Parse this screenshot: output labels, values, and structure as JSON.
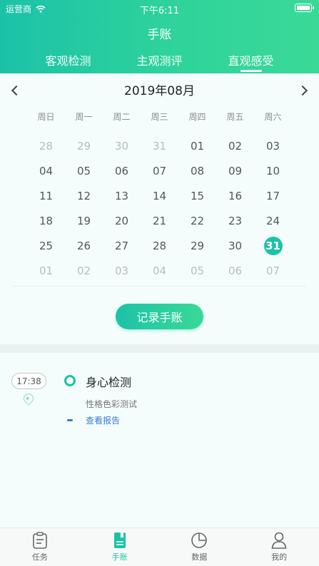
{
  "status_bar": {
    "carrier": "运营商",
    "time": "下午6:11"
  },
  "header": {
    "title": "手账"
  },
  "tabs": [
    {
      "label": "客观检测"
    },
    {
      "label": "主观测评"
    },
    {
      "label": "直观感受"
    }
  ],
  "calendar": {
    "month": "2019年08月",
    "weekdays": [
      "周日",
      "周一",
      "周二",
      "周三",
      "周四",
      "周五",
      "周六"
    ],
    "days": [
      {
        "d": "28",
        "muted": true
      },
      {
        "d": "29",
        "muted": true
      },
      {
        "d": "30",
        "muted": true
      },
      {
        "d": "31",
        "muted": true
      },
      {
        "d": "01"
      },
      {
        "d": "02"
      },
      {
        "d": "03"
      },
      {
        "d": "04"
      },
      {
        "d": "05"
      },
      {
        "d": "06"
      },
      {
        "d": "07"
      },
      {
        "d": "08"
      },
      {
        "d": "09"
      },
      {
        "d": "10"
      },
      {
        "d": "11"
      },
      {
        "d": "12"
      },
      {
        "d": "13"
      },
      {
        "d": "14"
      },
      {
        "d": "15"
      },
      {
        "d": "16"
      },
      {
        "d": "17"
      },
      {
        "d": "18"
      },
      {
        "d": "19"
      },
      {
        "d": "20"
      },
      {
        "d": "21"
      },
      {
        "d": "22"
      },
      {
        "d": "23"
      },
      {
        "d": "24"
      },
      {
        "d": "25"
      },
      {
        "d": "26"
      },
      {
        "d": "27"
      },
      {
        "d": "28"
      },
      {
        "d": "29"
      },
      {
        "d": "30"
      },
      {
        "d": "31",
        "selected": true
      },
      {
        "d": "01",
        "muted": true
      },
      {
        "d": "02",
        "muted": true
      },
      {
        "d": "03",
        "muted": true
      },
      {
        "d": "04",
        "muted": true
      },
      {
        "d": "05",
        "muted": true
      },
      {
        "d": "06",
        "muted": true
      },
      {
        "d": "07",
        "muted": true
      }
    ],
    "record_button": "记录手账"
  },
  "entry": {
    "time": "17:38",
    "title": "身心检测",
    "subtitle": "性格色彩测试",
    "link": "查看报告"
  },
  "bottom_nav": [
    {
      "label": "任务",
      "icon": "clipboard-icon"
    },
    {
      "label": "手账",
      "icon": "notebook-icon",
      "active": true
    },
    {
      "label": "数据",
      "icon": "pie-chart-icon"
    },
    {
      "label": "我的",
      "icon": "person-icon"
    }
  ],
  "colors": {
    "accent": "#1cc2a8",
    "accent_end": "#3ad998",
    "link": "#3a7bd5"
  }
}
